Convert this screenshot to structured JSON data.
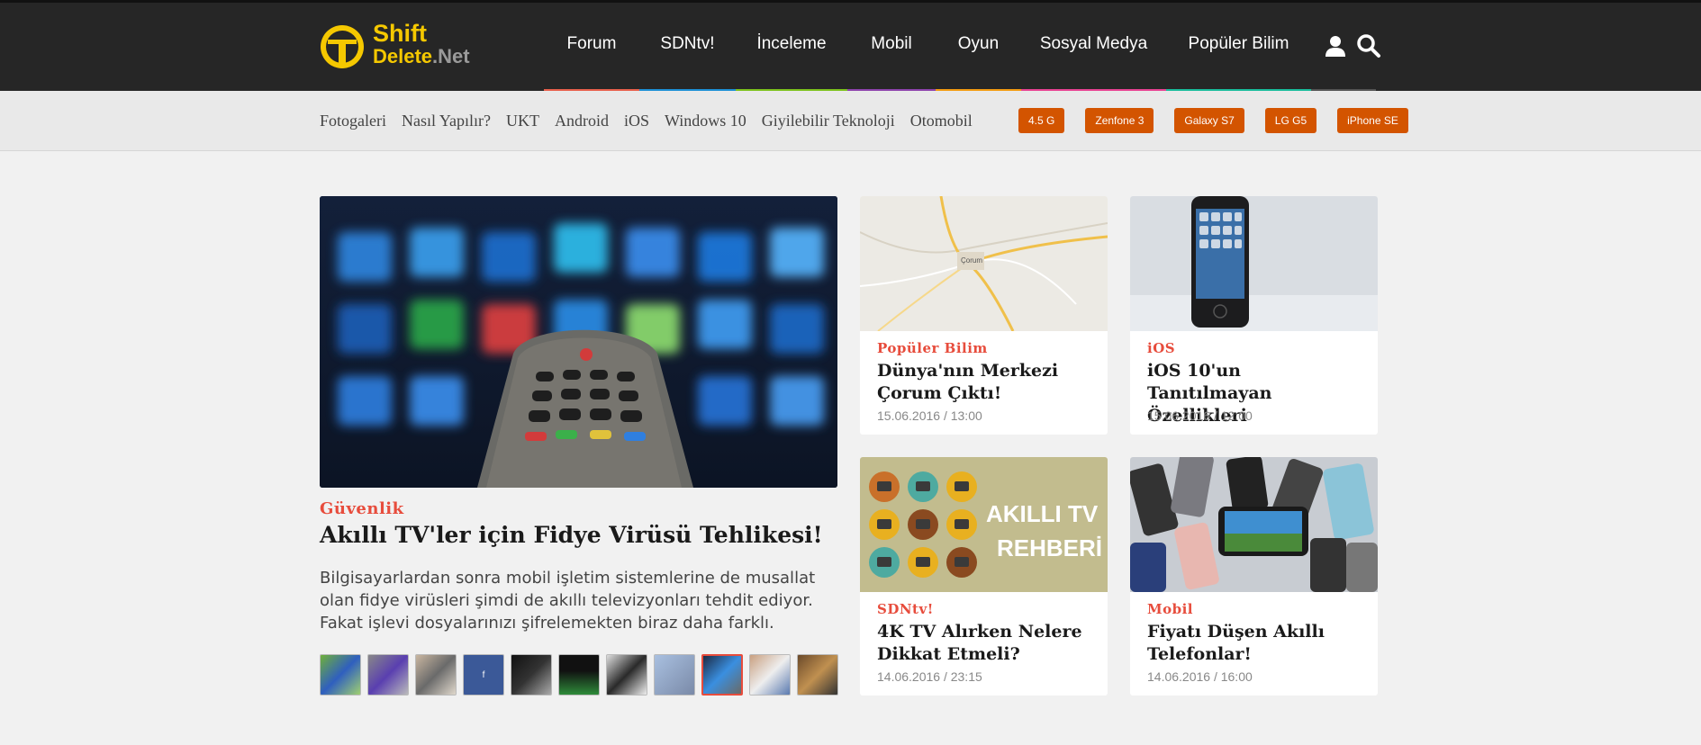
{
  "brand": {
    "logo_shift": "Shift",
    "logo_delete": "Delete",
    "logo_net": ".Net"
  },
  "main_nav": [
    {
      "label": "Forum",
      "color": "#e8604c"
    },
    {
      "label": "SDNtv!",
      "color": "#1e90d6"
    },
    {
      "label": "İnceleme",
      "color": "#7dc21e"
    },
    {
      "label": "Mobil",
      "color": "#8e44ad"
    },
    {
      "label": "Oyun",
      "color": "#f39c12"
    },
    {
      "label": "Sosyal Medya",
      "color": "#e84393"
    },
    {
      "label": "Popüler Bilim",
      "color": "#1abc9c"
    }
  ],
  "header_icons": [
    "user-icon",
    "search-icon"
  ],
  "sub_nav": [
    "Fotogaleri",
    "Nasıl Yapılır?",
    "UKT",
    "Android",
    "iOS",
    "Windows 10",
    "Giyilebilir Teknoloji",
    "Otomobil"
  ],
  "tags": [
    "4.5 G",
    "Zenfone 3",
    "Galaxy S7",
    "LG G5",
    "iPhone SE"
  ],
  "hero": {
    "category": "Güvenlik",
    "title": "Akıllı TV'ler için Fidye Virüsü Tehlikesi!",
    "excerpt": "Bilgisayarlardan sonra mobil işletim sistemlerine de musallat olan fidye virüsleri şimdi de akıllı televizyonları tehdit ediyor. Fakat işlevi dosyalarınızı şifrelemekten biraz daha farklı.",
    "thumb_count": 11,
    "active_thumb": 8
  },
  "cards": [
    {
      "category": "Popüler Bilim",
      "title": "Dünya'nın Merkezi Çorum Çıktı!",
      "date": "15.06.2016 / 13:00"
    },
    {
      "category": "iOS",
      "title": "iOS 10'un Tanıtılmayan Özellikleri",
      "date": "15.06.2016 / 12:00"
    },
    {
      "category": "SDNtv!",
      "title": "4K TV Alırken Nelere Dikkat Etmeli?",
      "date": "14.06.2016 / 23:15"
    },
    {
      "category": "Mobil",
      "title": "Fiyatı Düşen Akıllı Telefonlar!",
      "date": "14.06.2016 / 16:00"
    }
  ],
  "card_texts": {
    "tv_guide_line1": "AKILLI TV",
    "tv_guide_line2": "REHBERİ",
    "map_city": "Çorum"
  },
  "colors": {
    "accent": "#e74c3c",
    "tag_bg": "#d35400",
    "header_bg": "#262626",
    "logo_yellow": "#f5c800"
  }
}
